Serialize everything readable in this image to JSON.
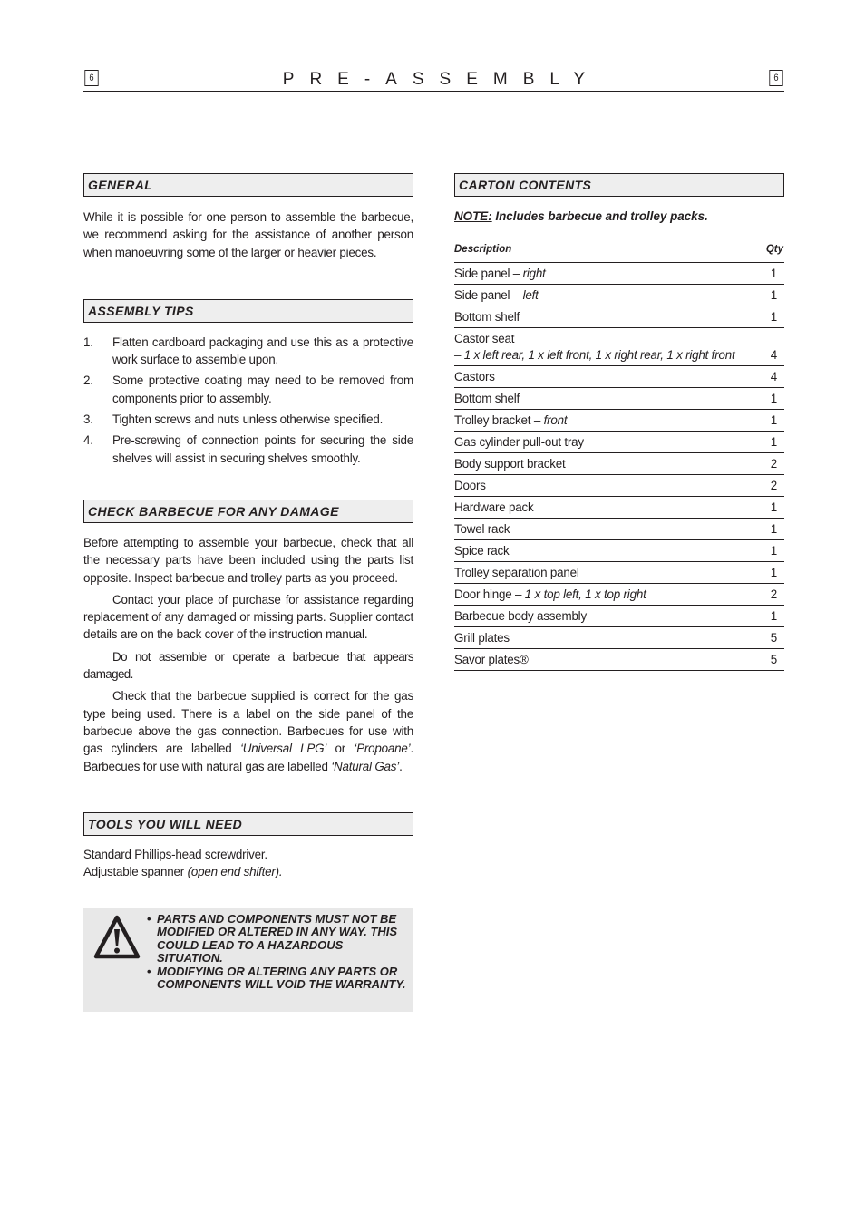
{
  "header": {
    "page_number_left": "6",
    "title": "PRE-ASSEMBLY",
    "page_number_right": "6"
  },
  "general": {
    "heading": "GENERAL",
    "text": "While it is possible for one person to assemble the barbecue, we recommend asking for the assistance of another person when manoeuvring some of the larger or heavier pieces."
  },
  "assembly_tips": {
    "heading": "ASSEMBLY TIPS",
    "items": [
      {
        "num": "1.",
        "text": "Flatten cardboard packaging and use this as a protective work surface to assemble upon."
      },
      {
        "num": "2.",
        "text": "Some protective coating may need to be removed from components prior to assembly."
      },
      {
        "num": "3.",
        "text": "Tighten screws and nuts unless otherwise specified."
      },
      {
        "num": "4.",
        "text": "Pre-screwing of connection points for securing the side shelves will assist in securing shelves smoothly."
      }
    ]
  },
  "damage": {
    "heading": "CHECK BARBECUE FOR ANY DAMAGE",
    "p1": "Before attempting to assemble your barbecue, check that all the necessary parts have been included using the parts list opposite. Inspect barbecue and trolley parts as you proceed.",
    "p2": "Contact your place of purchase for assistance regarding replacement of any damaged or missing parts.  Supplier contact details are on the back cover of the instruction manual.",
    "p3": "Do not assemble or operate a barbecue that appears damaged.",
    "p4_a": "Check that the barbecue supplied is correct for the gas type being used.  There is a label on the side panel of the barbecue above the gas connection.  Barbecues for use with gas cylinders are labelled ",
    "p4_lpg": "‘Universal LPG’",
    "p4_b": " or ",
    "p4_propane": "‘Propoane’",
    "p4_c": ".  Barbecues for use with natural gas are labelled ",
    "p4_natural": "‘Natural Gas’",
    "p4_d": "."
  },
  "tools": {
    "heading": "TOOLS YOU WILL NEED",
    "line1": "Standard Phillips-head screwdriver.",
    "line2_a": "Adjustable spanner ",
    "line2_b": "(open end shifter)."
  },
  "warning": {
    "icon": "warning-triangle-icon",
    "bullet": "•",
    "items": [
      "PARTS AND COMPONENTS MUST NOT BE MODIFIED OR ALTERED IN ANY WAY. THIS COULD LEAD TO A HAZARDOUS SITUATION.",
      "MODIFYING OR ALTERING ANY PARTS OR COMPONENTS WILL VOID THE WARRANTY."
    ]
  },
  "carton": {
    "heading": "CARTON CONTENTS",
    "note_label": "NOTE:",
    "note_text": " Includes barbecue and trolley packs.",
    "columns": {
      "description": "Description",
      "qty": "Qty"
    },
    "rows": [
      {
        "main": "Side panel – ",
        "detail": "right",
        "qty": "1"
      },
      {
        "main": "Side panel – ",
        "detail": "left",
        "qty": "1"
      },
      {
        "main": "Bottom shelf",
        "detail": "",
        "qty": "1"
      },
      {
        "main": "Castor seat",
        "detail": "– 1 x left rear, 1 x left front, 1 x right rear, 1 x right front",
        "qty": "4",
        "multiline": true
      },
      {
        "main": "Castors",
        "detail": "",
        "qty": "4"
      },
      {
        "main": "Bottom shelf",
        "detail": "",
        "qty": "1"
      },
      {
        "main": "Trolley bracket – ",
        "detail": "front",
        "qty": "1"
      },
      {
        "main": "Gas cylinder pull-out tray",
        "detail": "",
        "qty": "1"
      },
      {
        "main": "Body support bracket",
        "detail": "",
        "qty": "2"
      },
      {
        "main": "Doors",
        "detail": "",
        "qty": "2"
      },
      {
        "main": "Hardware pack",
        "detail": "",
        "qty": "1"
      },
      {
        "main": "Towel rack",
        "detail": "",
        "qty": "1"
      },
      {
        "main": "Spice rack",
        "detail": "",
        "qty": "1"
      },
      {
        "main": "Trolley separation panel",
        "detail": "",
        "qty": "1"
      },
      {
        "main": "Door hinge – ",
        "detail": "1 x top left, 1 x top right",
        "qty": "2"
      },
      {
        "main": "Barbecue body assembly",
        "detail": "",
        "qty": "1"
      },
      {
        "main": "Grill plates",
        "detail": "",
        "qty": "5"
      },
      {
        "main": "Savor plates®",
        "detail": "",
        "qty": "5"
      }
    ]
  }
}
